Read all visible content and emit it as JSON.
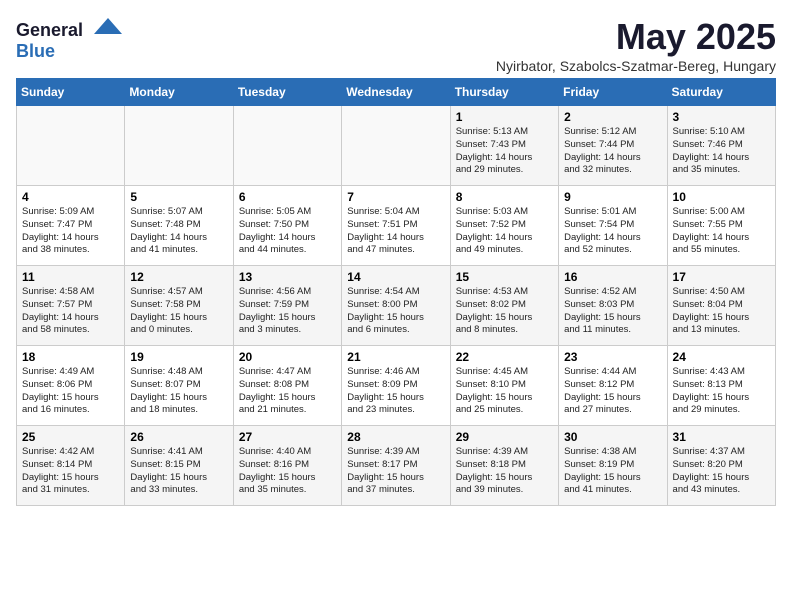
{
  "header": {
    "logo_general": "General",
    "logo_blue": "Blue",
    "month_title": "May 2025",
    "subtitle": "Nyirbator, Szabolcs-Szatmar-Bereg, Hungary"
  },
  "weekdays": [
    "Sunday",
    "Monday",
    "Tuesday",
    "Wednesday",
    "Thursday",
    "Friday",
    "Saturday"
  ],
  "weeks": [
    [
      {
        "day": "",
        "info": ""
      },
      {
        "day": "",
        "info": ""
      },
      {
        "day": "",
        "info": ""
      },
      {
        "day": "",
        "info": ""
      },
      {
        "day": "1",
        "info": "Sunrise: 5:13 AM\nSunset: 7:43 PM\nDaylight: 14 hours\nand 29 minutes."
      },
      {
        "day": "2",
        "info": "Sunrise: 5:12 AM\nSunset: 7:44 PM\nDaylight: 14 hours\nand 32 minutes."
      },
      {
        "day": "3",
        "info": "Sunrise: 5:10 AM\nSunset: 7:46 PM\nDaylight: 14 hours\nand 35 minutes."
      }
    ],
    [
      {
        "day": "4",
        "info": "Sunrise: 5:09 AM\nSunset: 7:47 PM\nDaylight: 14 hours\nand 38 minutes."
      },
      {
        "day": "5",
        "info": "Sunrise: 5:07 AM\nSunset: 7:48 PM\nDaylight: 14 hours\nand 41 minutes."
      },
      {
        "day": "6",
        "info": "Sunrise: 5:05 AM\nSunset: 7:50 PM\nDaylight: 14 hours\nand 44 minutes."
      },
      {
        "day": "7",
        "info": "Sunrise: 5:04 AM\nSunset: 7:51 PM\nDaylight: 14 hours\nand 47 minutes."
      },
      {
        "day": "8",
        "info": "Sunrise: 5:03 AM\nSunset: 7:52 PM\nDaylight: 14 hours\nand 49 minutes."
      },
      {
        "day": "9",
        "info": "Sunrise: 5:01 AM\nSunset: 7:54 PM\nDaylight: 14 hours\nand 52 minutes."
      },
      {
        "day": "10",
        "info": "Sunrise: 5:00 AM\nSunset: 7:55 PM\nDaylight: 14 hours\nand 55 minutes."
      }
    ],
    [
      {
        "day": "11",
        "info": "Sunrise: 4:58 AM\nSunset: 7:57 PM\nDaylight: 14 hours\nand 58 minutes."
      },
      {
        "day": "12",
        "info": "Sunrise: 4:57 AM\nSunset: 7:58 PM\nDaylight: 15 hours\nand 0 minutes."
      },
      {
        "day": "13",
        "info": "Sunrise: 4:56 AM\nSunset: 7:59 PM\nDaylight: 15 hours\nand 3 minutes."
      },
      {
        "day": "14",
        "info": "Sunrise: 4:54 AM\nSunset: 8:00 PM\nDaylight: 15 hours\nand 6 minutes."
      },
      {
        "day": "15",
        "info": "Sunrise: 4:53 AM\nSunset: 8:02 PM\nDaylight: 15 hours\nand 8 minutes."
      },
      {
        "day": "16",
        "info": "Sunrise: 4:52 AM\nSunset: 8:03 PM\nDaylight: 15 hours\nand 11 minutes."
      },
      {
        "day": "17",
        "info": "Sunrise: 4:50 AM\nSunset: 8:04 PM\nDaylight: 15 hours\nand 13 minutes."
      }
    ],
    [
      {
        "day": "18",
        "info": "Sunrise: 4:49 AM\nSunset: 8:06 PM\nDaylight: 15 hours\nand 16 minutes."
      },
      {
        "day": "19",
        "info": "Sunrise: 4:48 AM\nSunset: 8:07 PM\nDaylight: 15 hours\nand 18 minutes."
      },
      {
        "day": "20",
        "info": "Sunrise: 4:47 AM\nSunset: 8:08 PM\nDaylight: 15 hours\nand 21 minutes."
      },
      {
        "day": "21",
        "info": "Sunrise: 4:46 AM\nSunset: 8:09 PM\nDaylight: 15 hours\nand 23 minutes."
      },
      {
        "day": "22",
        "info": "Sunrise: 4:45 AM\nSunset: 8:10 PM\nDaylight: 15 hours\nand 25 minutes."
      },
      {
        "day": "23",
        "info": "Sunrise: 4:44 AM\nSunset: 8:12 PM\nDaylight: 15 hours\nand 27 minutes."
      },
      {
        "day": "24",
        "info": "Sunrise: 4:43 AM\nSunset: 8:13 PM\nDaylight: 15 hours\nand 29 minutes."
      }
    ],
    [
      {
        "day": "25",
        "info": "Sunrise: 4:42 AM\nSunset: 8:14 PM\nDaylight: 15 hours\nand 31 minutes."
      },
      {
        "day": "26",
        "info": "Sunrise: 4:41 AM\nSunset: 8:15 PM\nDaylight: 15 hours\nand 33 minutes."
      },
      {
        "day": "27",
        "info": "Sunrise: 4:40 AM\nSunset: 8:16 PM\nDaylight: 15 hours\nand 35 minutes."
      },
      {
        "day": "28",
        "info": "Sunrise: 4:39 AM\nSunset: 8:17 PM\nDaylight: 15 hours\nand 37 minutes."
      },
      {
        "day": "29",
        "info": "Sunrise: 4:39 AM\nSunset: 8:18 PM\nDaylight: 15 hours\nand 39 minutes."
      },
      {
        "day": "30",
        "info": "Sunrise: 4:38 AM\nSunset: 8:19 PM\nDaylight: 15 hours\nand 41 minutes."
      },
      {
        "day": "31",
        "info": "Sunrise: 4:37 AM\nSunset: 8:20 PM\nDaylight: 15 hours\nand 43 minutes."
      }
    ]
  ]
}
